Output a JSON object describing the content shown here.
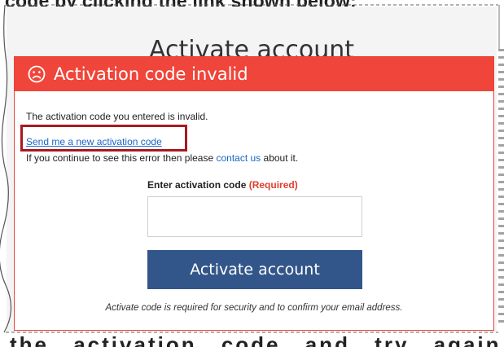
{
  "background": {
    "top_text": "code by clicking the link shown below:",
    "bottom_text": "the activation code and try again."
  },
  "page": {
    "title": "Activate account"
  },
  "alert": {
    "title": "Activation code invalid",
    "icon": "frown-icon",
    "color": "#f0453a"
  },
  "body": {
    "message": "The activation code you entered is invalid.",
    "resend_link": "Send me a new activation code",
    "help_prefix": "If you continue to see this error then please ",
    "help_link": "contact us",
    "help_suffix": " about it."
  },
  "form": {
    "label": "Enter activation code",
    "required": "(Required)",
    "input_value": "",
    "submit_label": "Activate account",
    "footnote": "Activate code is required for security and to confirm your email address."
  },
  "colors": {
    "button": "#33568a",
    "link": "#1a66c7",
    "highlight": "#a8191f"
  }
}
